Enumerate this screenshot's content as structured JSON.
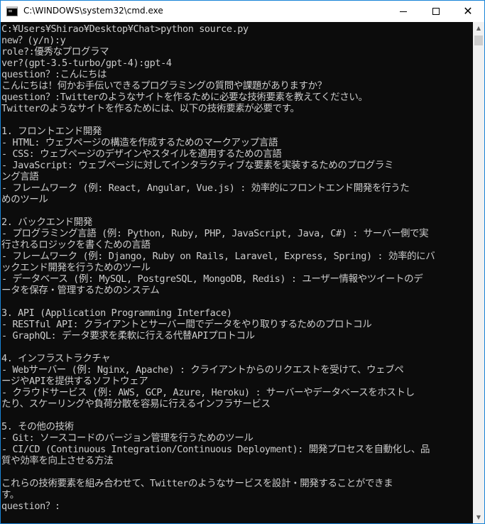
{
  "window": {
    "title": "C:\\WINDOWS\\system32\\cmd.exe",
    "minimize_glyph": "",
    "maximize_glyph": "",
    "close_glyph": "✕"
  },
  "scrollbar": {
    "up_arrow": "▲",
    "down_arrow": "▼"
  },
  "console": {
    "lines": [
      "C:¥Users¥Shirao¥Desktop¥Chat>python source.py",
      "new？(y/n):y",
      "role?:優秀なプログラマ",
      "ver?(gpt-3.5-turbo/gpt-4):gpt-4",
      "question？:こんにちは",
      "こんにちは！何かお手伝いできるプログラミングの質問や課題がありますか？",
      "question？:Twitterのようなサイトを作るために必要な技術要素を教えてください。",
      "Twitterのようなサイトを作るためには、以下の技術要素が必要です。",
      "",
      "1. フロントエンド開発",
      "- HTML: ウェブページの構造を作成するためのマークアップ言語",
      "- CSS: ウェブページのデザインやスタイルを適用するための言語",
      "- JavaScript: ウェブページに対してインタラクティブな要素を実装するためのプログラミ",
      "ング言語",
      "- フレームワーク (例: React, Angular, Vue.js) : 効率的にフロントエンド開発を行うた",
      "めのツール",
      "",
      "2. バックエンド開発",
      "- プログラミング言語 (例: Python, Ruby, PHP, JavaScript, Java, C#) : サーバー側で実",
      "行されるロジックを書くための言語",
      "- フレームワーク (例: Django, Ruby on Rails, Laravel, Express, Spring) : 効率的にバ",
      "ックエンド開発を行うためのツール",
      "- データベース (例: MySQL, PostgreSQL, MongoDB, Redis) : ユーザー情報やツイートのデ",
      "ータを保存・管理するためのシステム",
      "",
      "3. API (Application Programming Interface)",
      "- RESTful API: クライアントとサーバー間でデータをやり取りするためのプロトコル",
      "- GraphQL: データ要求を柔軟に行える代替APIプロトコル",
      "",
      "4. インフラストラクチャ",
      "- Webサーバー (例: Nginx, Apache) : クライアントからのリクエストを受けて、ウェブペ",
      "ージやAPIを提供するソフトウェア",
      "- クラウドサービス (例: AWS, GCP, Azure, Heroku) : サーバーやデータベースをホストし",
      "たり、スケーリングや負荷分散を容易に行えるインフラサービス",
      "",
      "5. その他の技術",
      "- Git: ソースコードのバージョン管理を行うためのツール",
      "- CI/CD (Continuous Integration/Continuous Deployment): 開発プロセスを自動化し、品",
      "質や効率を向上させる方法",
      "",
      "これらの技術要素を組み合わせて、Twitterのようなサービスを設計・開発することができま",
      "す。",
      "question？:"
    ]
  }
}
